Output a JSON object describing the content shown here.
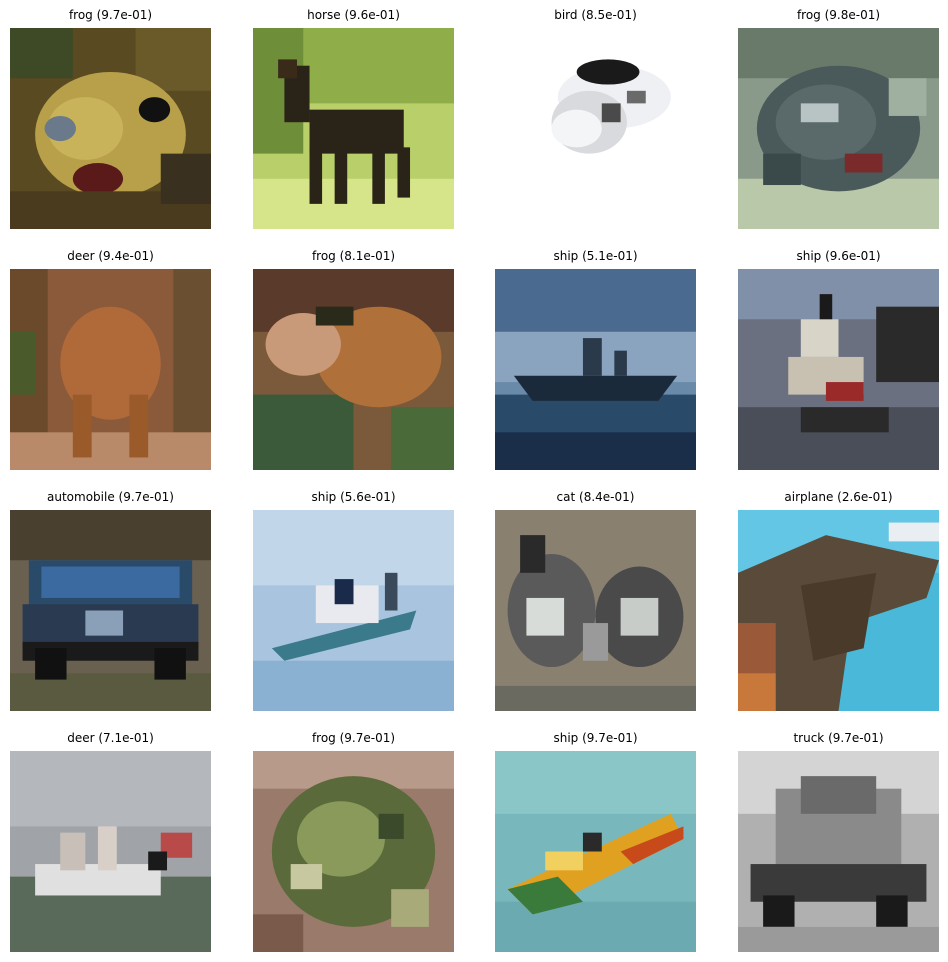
{
  "figure": {
    "panels": [
      {
        "label": "frog (9.7e-01)"
      },
      {
        "label": "horse (9.6e-01)"
      },
      {
        "label": "bird (8.5e-01)"
      },
      {
        "label": "frog (9.8e-01)"
      },
      {
        "label": "deer (9.4e-01)"
      },
      {
        "label": "frog (8.1e-01)"
      },
      {
        "label": "ship (5.1e-01)"
      },
      {
        "label": "ship (9.6e-01)"
      },
      {
        "label": "automobile (9.7e-01)"
      },
      {
        "label": "ship (5.6e-01)"
      },
      {
        "label": "cat (8.4e-01)"
      },
      {
        "label": "airplane (2.6e-01)"
      },
      {
        "label": "deer (7.1e-01)"
      },
      {
        "label": "frog (9.7e-01)"
      },
      {
        "label": "ship (9.7e-01)"
      },
      {
        "label": "truck (9.7e-01)"
      }
    ]
  }
}
